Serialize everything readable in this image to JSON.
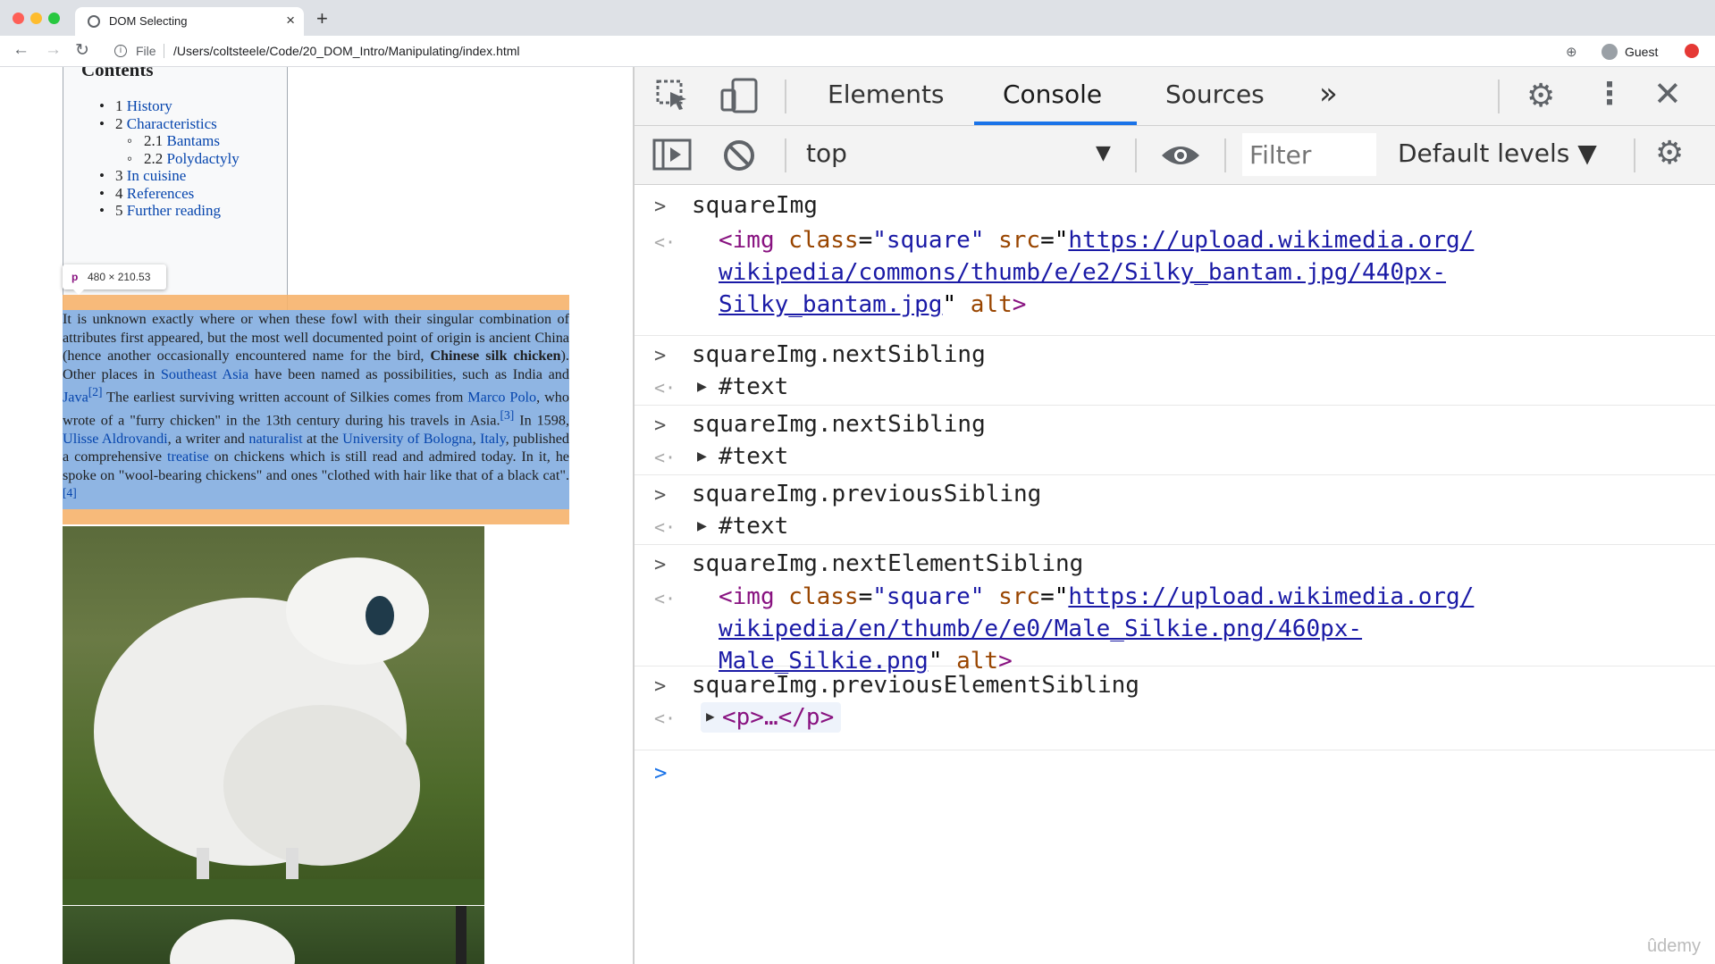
{
  "browser": {
    "tab_title": "DOM Selecting",
    "url_scheme": "File",
    "url": "/Users/coltsteele/Code/20_DOM_Intro/Manipulating/index.html",
    "profile": "Guest"
  },
  "page": {
    "toc_title": "Contents",
    "toc": [
      {
        "num": "1",
        "label": "History"
      },
      {
        "num": "2",
        "label": "Characteristics"
      },
      {
        "num": "2.1",
        "label": "Bantams"
      },
      {
        "num": "2.2",
        "label": "Polydactyly"
      },
      {
        "num": "3",
        "label": "In cuisine"
      },
      {
        "num": "4",
        "label": "References"
      },
      {
        "num": "5",
        "label": "Further reading"
      }
    ],
    "inspect_tooltip": {
      "tag": "p",
      "dims": "480 × 210.53"
    },
    "paragraph": {
      "t1": "It is unknown exactly where or when these fowl with their singular combination of attributes first appeared, but the most well documented point of origin is ancient China (hence another occasionally encountered name for the bird, ",
      "bold": "Chinese silk chicken",
      "t2": "). Other places in ",
      "l1": "Southeast Asia",
      "t3": " have been named as possibilities, such as India and ",
      "l2": "Java",
      "r2": "[2]",
      "t4": " The earliest surviving written account of Silkies comes from ",
      "l3": "Marco Polo",
      "t5": ", who wrote of a \"furry chicken\" in the 13th century during his travels in Asia.",
      "r3": "[3]",
      "t6": " In 1598, ",
      "l4": "Ulisse Aldrovandi",
      "t7": ", a writer and ",
      "l5": "naturalist",
      "t8": " at the ",
      "l6": "University of Bologna",
      "t9": ", ",
      "l7": "Italy",
      "t10": ", published a comprehensive ",
      "l8": "treatise",
      "t11": " on chickens which is still read and admired today. In it, he spoke on \"wool-bearing chickens\" and ones \"clothed with hair like that of a black cat\".",
      "r4": "[4]"
    }
  },
  "devtools": {
    "tabs": [
      "Elements",
      "Console",
      "Sources"
    ],
    "more_tabs": "»",
    "context": "top",
    "filter_placeholder": "Filter",
    "levels": "Default levels ▼",
    "console": [
      {
        "cmd": "squareImg",
        "out_tag_open": "<img",
        "attr_class": "class",
        "val_class": "\"square\"",
        "attr_src": "src",
        "src_l1": "https://upload.wikimedia.org/",
        "src_l2": "wikipedia/commons/thumb/e/e2/Silky_bantam.jpg/440px-",
        "src_l3": "Silky_bantam.jpg",
        "attr_alt": "alt",
        "tag_close": ">"
      },
      {
        "cmd": "squareImg.nextSibling",
        "out": "#text"
      },
      {
        "cmd": "squareImg.nextSibling",
        "out": "#text"
      },
      {
        "cmd": "squareImg.previousSibling",
        "out": "#text"
      },
      {
        "cmd": "squareImg.nextElementSibling",
        "out_tag_open": "<img",
        "attr_class": "class",
        "val_class": "\"square\"",
        "attr_src": "src",
        "src_l1": "https://upload.wikimedia.org/",
        "src_l2": "wikipedia/en/thumb/e/e0/Male_Silkie.png/460px-",
        "src_l3": "Male_Silkie.png",
        "attr_alt": "alt",
        "tag_close": ">"
      },
      {
        "cmd": "squareImg.previousElementSibling",
        "out": "<p>…</p>"
      }
    ]
  },
  "watermark": "ûdemy",
  "colors": {
    "accent": "#1a73e8",
    "highlight_content": "#8fb5e3",
    "highlight_margin": "#f6b26b"
  }
}
